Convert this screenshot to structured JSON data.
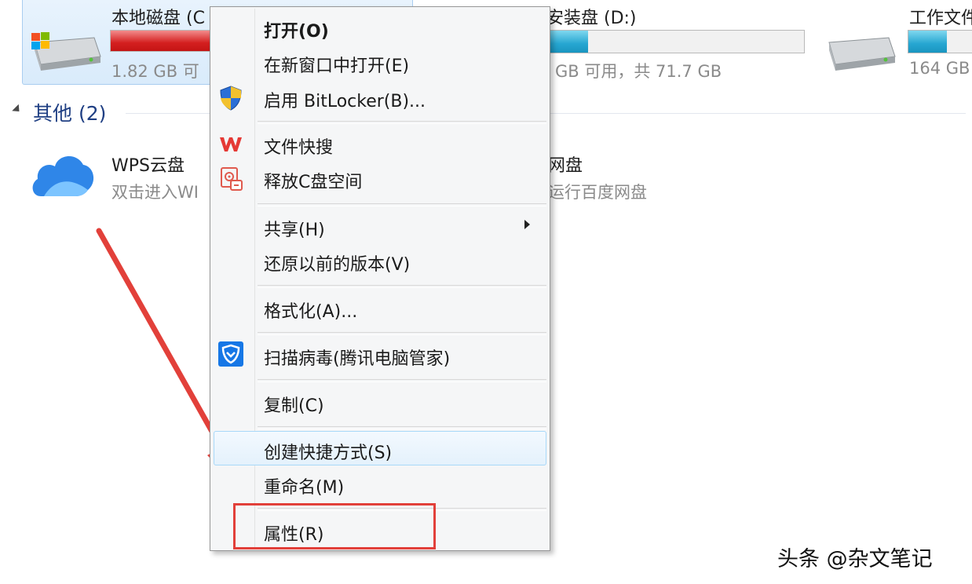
{
  "drives": [
    {
      "name": "本地磁盘 (C",
      "free_text": "1.82 GB 可",
      "used_fraction": 0.92,
      "bar_color": "#d41f1f"
    },
    {
      "name": "软件安装盘 (D:)",
      "free_text": "GB 可用，共 71.7 GB",
      "used_fraction": 0.35,
      "bar_color": "#26a6d1"
    },
    {
      "name": "工作文件",
      "free_text": "164 GB",
      "used_fraction": 0.5,
      "bar_color": "#26a6d1"
    }
  ],
  "other_group": {
    "label": "其他 (2)"
  },
  "cloud_items": [
    {
      "name": "WPS云盘",
      "desc": "双击进入WI"
    },
    {
      "name": "网盘",
      "desc": "运行百度网盘"
    }
  ],
  "context_menu": {
    "open": "打开(O)",
    "open_new_window": "在新窗口中打开(E)",
    "bitlocker": "启用 BitLocker(B)...",
    "file_search": "文件快搜",
    "free_c_space": "释放C盘空间",
    "share": "共享(H)",
    "restore_versions": "还原以前的版本(V)",
    "format": "格式化(A)...",
    "scan_virus": "扫描病毒(腾讯电脑管家)",
    "copy": "复制(C)",
    "create_shortcut": "创建快捷方式(S)",
    "rename": "重命名(M)",
    "properties": "属性(R)"
  },
  "watermark": "头条 @杂文笔记",
  "colors": {
    "annotation_red": "#e2403a",
    "menu_hover": "#e4f1fc",
    "group_header": "#1f3f83"
  }
}
